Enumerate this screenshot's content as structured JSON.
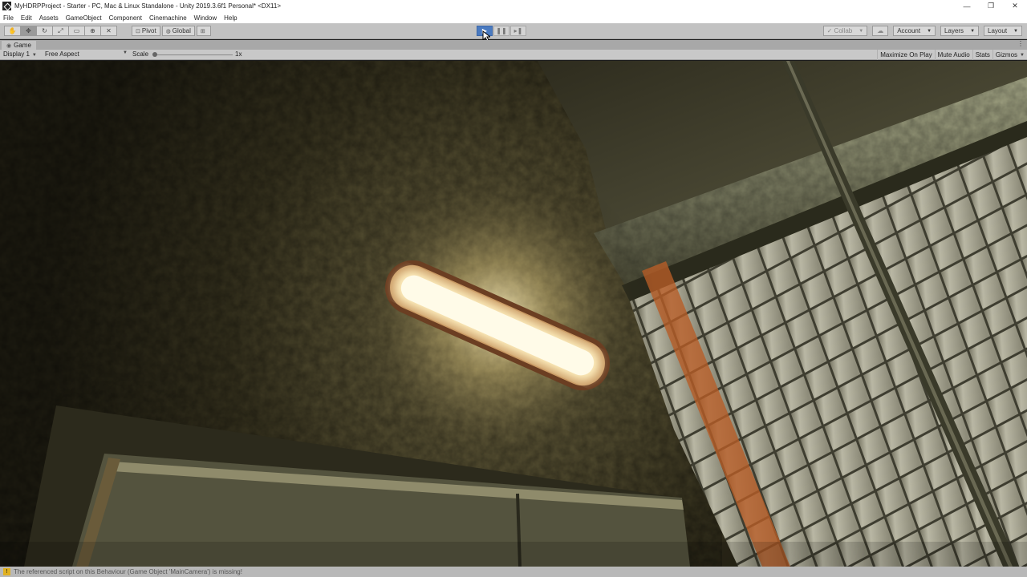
{
  "window": {
    "title": "MyHDRPProject - Starter - PC, Mac & Linux Standalone - Unity 2019.3.6f1 Personal* <DX11>",
    "controls": [
      "—",
      "❐",
      "✕"
    ]
  },
  "menu": [
    "File",
    "Edit",
    "Assets",
    "GameObject",
    "Component",
    "Cinemachine",
    "Window",
    "Help"
  ],
  "toolbar": {
    "tools": [
      "hand-tool",
      "move-tool",
      "rotate-tool",
      "scale-tool",
      "rect-tool",
      "transform-tool",
      "custom-tool"
    ],
    "pivot_label": "Pivot",
    "global_label": "Global",
    "collab_label": "Collab",
    "account_label": "Account",
    "layers_label": "Layers",
    "layout_label": "Layout"
  },
  "game_tab": {
    "label": "Game"
  },
  "game_options": {
    "display": "Display 1",
    "aspect": "Free Aspect",
    "scale_label": "Scale",
    "scale_value": "1x",
    "maximize": "Maximize On Play",
    "mute": "Mute Audio",
    "stats": "Stats",
    "gizmos": "Gizmos"
  },
  "status": {
    "message": "The referenced script on this Behaviour (Game Object 'MainCamera') is missing!"
  },
  "colors": {
    "play_active": "#4a7ac0",
    "wall": "#3a3620",
    "tile": "#c9c6b2",
    "lamp": "#ffe9b0",
    "orange_stripe": "#c86a2a"
  }
}
